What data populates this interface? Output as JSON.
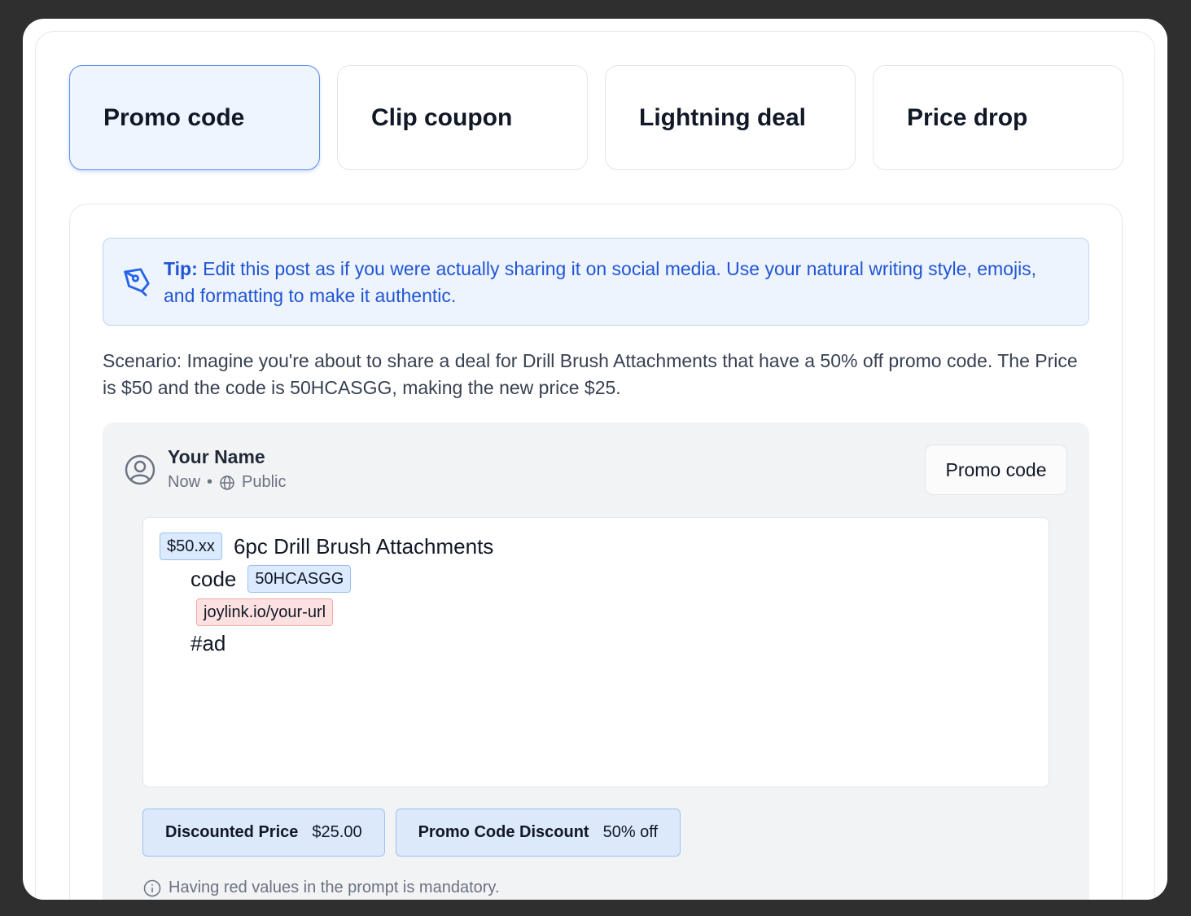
{
  "tabs": [
    {
      "label": "Promo code",
      "active": true
    },
    {
      "label": "Clip coupon",
      "active": false
    },
    {
      "label": "Lightning deal",
      "active": false
    },
    {
      "label": "Price drop",
      "active": false
    }
  ],
  "tip": {
    "icon": "pen-nib-icon",
    "prefix": "Tip:",
    "text": "Edit this post as if you were actually sharing it on social media. Use your natural writing style, emojis, and formatting to make it authentic."
  },
  "scenario": "Scenario: Imagine you're about to share a deal for Drill Brush Attachments that have a 50% off promo code. The Price is $50 and the code is 50HCASGG, making the new price $25.",
  "post": {
    "author": "Your Name",
    "time": "Now",
    "separator": "•",
    "visibility": "Public",
    "type_chip": "Promo code",
    "editor": {
      "price_tag": "$50.xx",
      "title": "6pc Drill Brush Attachments",
      "code_label": "code",
      "code_tag": "50HCASGG",
      "link_tag": "joylink.io/your-url",
      "hashtag": "#ad"
    },
    "stats": [
      {
        "label": "Discounted Price",
        "value": "$25.00"
      },
      {
        "label": "Promo Code Discount",
        "value": "50% off"
      }
    ],
    "note": "Having red values in the prompt is mandatory."
  }
}
